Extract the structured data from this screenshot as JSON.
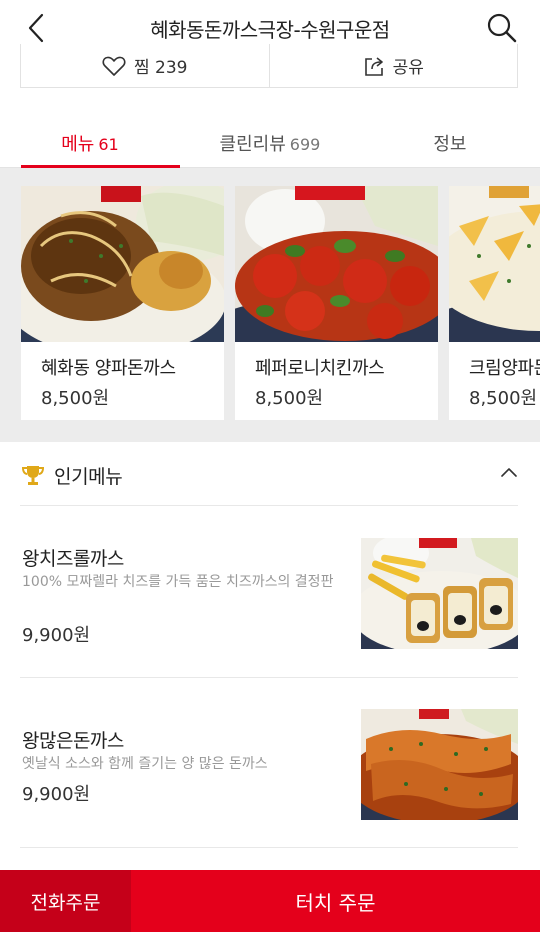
{
  "header": {
    "title": "혜화동돈까스극장-수원구운점"
  },
  "actions": {
    "like_label": "찜 239",
    "share_label": "공유"
  },
  "tabs": [
    {
      "label": "메뉴",
      "count": "61"
    },
    {
      "label": "클린리뷰",
      "count": "699"
    },
    {
      "label": "정보",
      "count": ""
    }
  ],
  "featured": [
    {
      "name": "혜화동 양파돈까스",
      "price": "8,500원"
    },
    {
      "name": "페퍼로니치킨까스",
      "price": "8,500원"
    },
    {
      "name": "크림양파돈",
      "price": "8,500원"
    }
  ],
  "popular": {
    "title": "인기메뉴",
    "items": [
      {
        "name": "왕치즈롤까스",
        "desc": "100% 모짜렐라 치즈를 가득 품은 치즈까스의 결정판",
        "price": "9,900원"
      },
      {
        "name": "왕많은돈까스",
        "desc": "옛날식 소스와 함께 즐기는 양 많은 돈까스",
        "price": "9,900원"
      }
    ]
  },
  "bottom": {
    "call_label": "전화주문",
    "touch_label": "터치 주문"
  },
  "colors": {
    "accent": "#e4001b",
    "accent_dark": "#c50019",
    "carousel_bg": "#ececec"
  },
  "icons": [
    "back-arrow-icon",
    "search-icon",
    "heart-icon",
    "share-icon",
    "trophy-icon",
    "chevron-up-icon"
  ]
}
